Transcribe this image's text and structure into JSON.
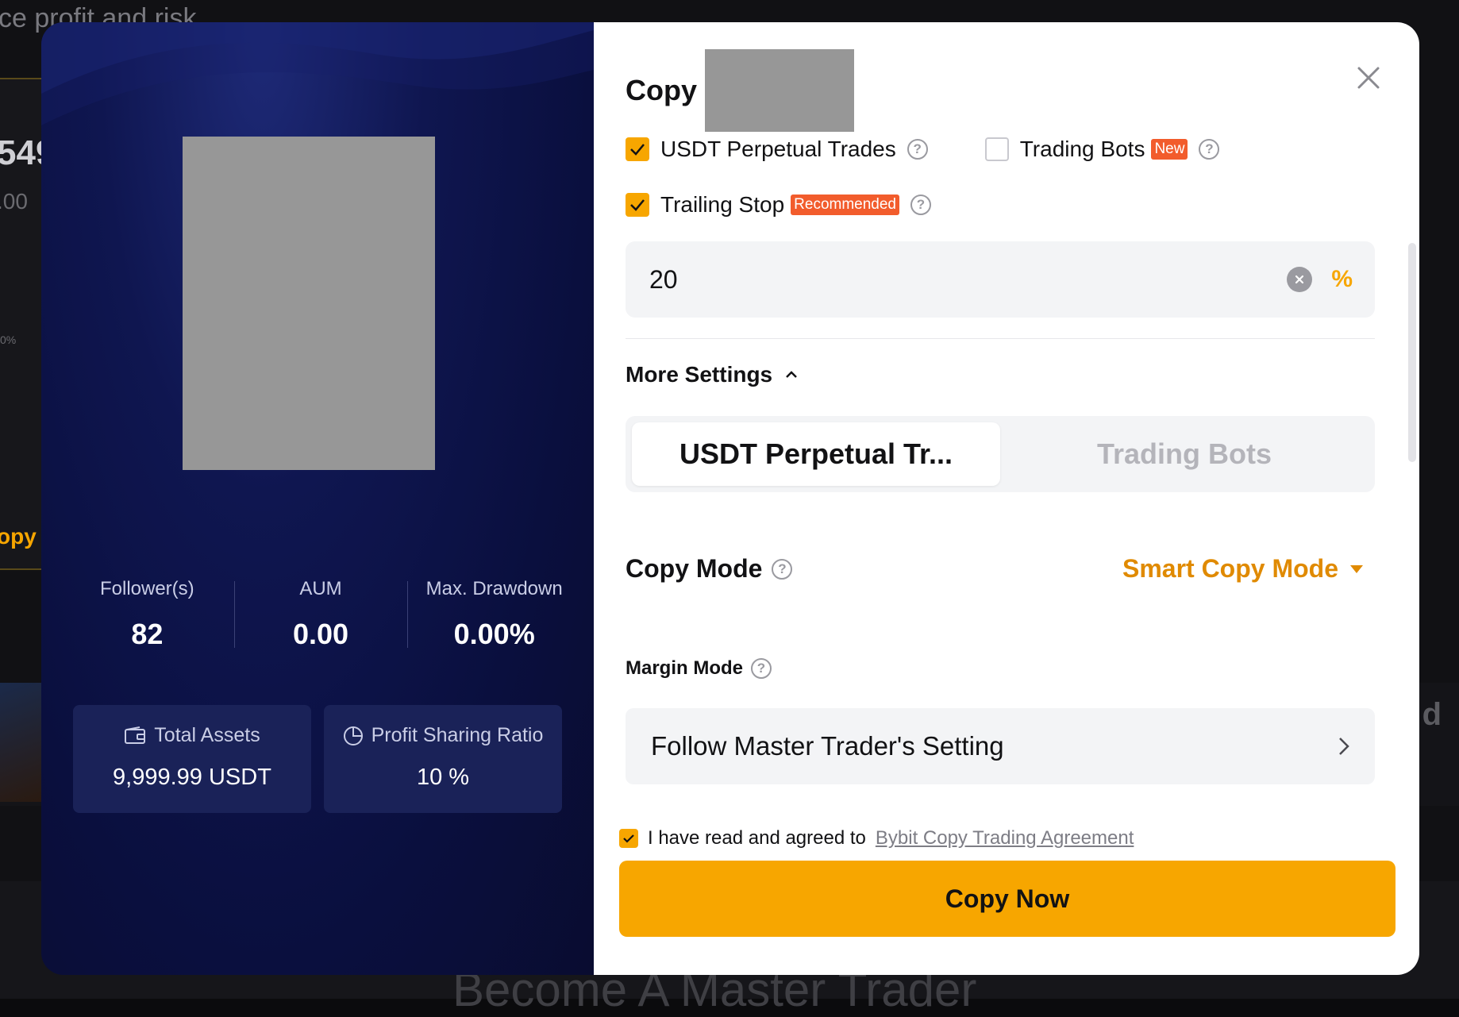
{
  "background": {
    "top_text": "ce profit and risk",
    "big_number": "549",
    "sub_number": ".00",
    "pct": "0%",
    "copy_label": "opy",
    "right_letter": "d",
    "bottom_heading": "Become A Master Trader"
  },
  "profile": {
    "stats": [
      {
        "label": "Follower(s)",
        "value": "82"
      },
      {
        "label": "AUM",
        "value": "0.00"
      },
      {
        "label": "Max. Drawdown",
        "value": "0.00%"
      }
    ],
    "total_assets": {
      "label": "Total Assets",
      "value": "9,999.99 USDT"
    },
    "profit_sharing": {
      "label": "Profit Sharing Ratio",
      "value": "10 %"
    }
  },
  "dialog": {
    "title": "Copy",
    "options": {
      "usdt_perpetual": {
        "label": "USDT Perpetual Trades",
        "checked": true
      },
      "trading_bots": {
        "label": "Trading Bots",
        "badge": "New",
        "checked": false
      },
      "trailing_stop": {
        "label": "Trailing Stop",
        "badge": "Recommended",
        "checked": true
      }
    },
    "trailing_input": {
      "value": "20",
      "unit": "%"
    },
    "more_settings": "More Settings",
    "tabs": [
      {
        "label": "USDT Perpetual Tr...",
        "active": true
      },
      {
        "label": "Trading Bots",
        "active": false
      }
    ],
    "copy_mode": {
      "label": "Copy Mode",
      "value": "Smart Copy Mode"
    },
    "margin_mode": {
      "label": "Margin Mode",
      "value": "Follow Master Trader's Setting"
    },
    "agreement": {
      "text": "I have read and agreed to",
      "link": "Bybit Copy Trading Agreement",
      "checked": true
    },
    "copy_button": "Copy Now"
  },
  "colors": {
    "accent": "#f7a600",
    "accent_text": "#e08a00",
    "badge": "#f25c2c",
    "panel_bg": "#0f1650"
  }
}
